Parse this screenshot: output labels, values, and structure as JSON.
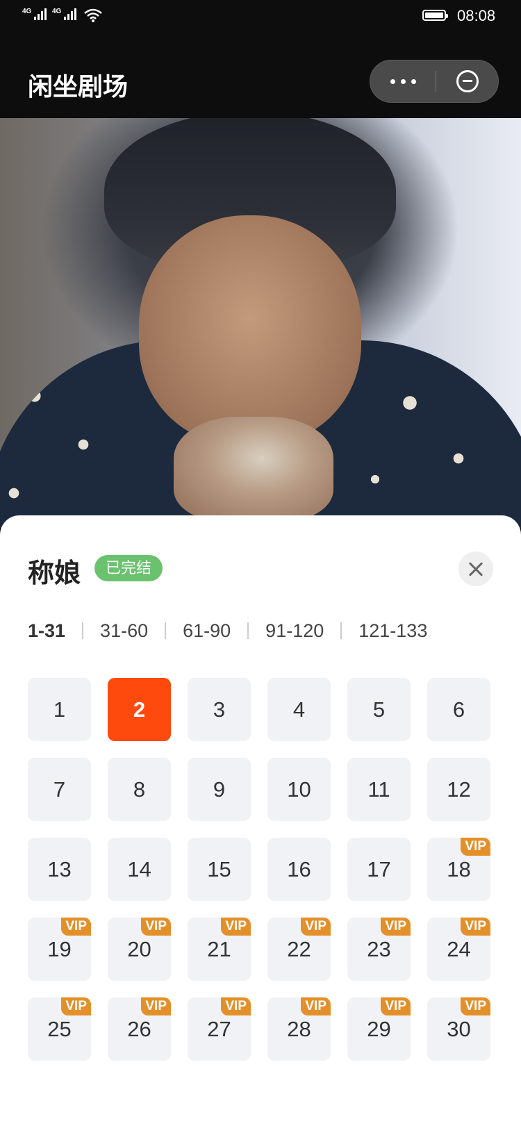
{
  "status_bar": {
    "signal1_label": "4G",
    "signal2_label": "4G",
    "time": "08:08"
  },
  "header": {
    "title": "闲坐剧场"
  },
  "sheet": {
    "title": "称娘",
    "status": "已完结",
    "ranges": [
      {
        "label": "1-31",
        "active": true
      },
      {
        "label": "31-60",
        "active": false
      },
      {
        "label": "61-90",
        "active": false
      },
      {
        "label": "91-120",
        "active": false
      },
      {
        "label": "121-133",
        "active": false
      }
    ],
    "vip_label": "VIP",
    "episodes": [
      {
        "num": "1",
        "vip": false,
        "active": false
      },
      {
        "num": "2",
        "vip": false,
        "active": true
      },
      {
        "num": "3",
        "vip": false,
        "active": false
      },
      {
        "num": "4",
        "vip": false,
        "active": false
      },
      {
        "num": "5",
        "vip": false,
        "active": false
      },
      {
        "num": "6",
        "vip": false,
        "active": false
      },
      {
        "num": "7",
        "vip": false,
        "active": false
      },
      {
        "num": "8",
        "vip": false,
        "active": false
      },
      {
        "num": "9",
        "vip": false,
        "active": false
      },
      {
        "num": "10",
        "vip": false,
        "active": false
      },
      {
        "num": "11",
        "vip": false,
        "active": false
      },
      {
        "num": "12",
        "vip": false,
        "active": false
      },
      {
        "num": "13",
        "vip": false,
        "active": false
      },
      {
        "num": "14",
        "vip": false,
        "active": false
      },
      {
        "num": "15",
        "vip": false,
        "active": false
      },
      {
        "num": "16",
        "vip": false,
        "active": false
      },
      {
        "num": "17",
        "vip": false,
        "active": false
      },
      {
        "num": "18",
        "vip": true,
        "active": false
      },
      {
        "num": "19",
        "vip": true,
        "active": false
      },
      {
        "num": "20",
        "vip": true,
        "active": false
      },
      {
        "num": "21",
        "vip": true,
        "active": false
      },
      {
        "num": "22",
        "vip": true,
        "active": false
      },
      {
        "num": "23",
        "vip": true,
        "active": false
      },
      {
        "num": "24",
        "vip": true,
        "active": false
      },
      {
        "num": "25",
        "vip": true,
        "active": false
      },
      {
        "num": "26",
        "vip": true,
        "active": false
      },
      {
        "num": "27",
        "vip": true,
        "active": false
      },
      {
        "num": "28",
        "vip": true,
        "active": false
      },
      {
        "num": "29",
        "vip": true,
        "active": false
      },
      {
        "num": "30",
        "vip": true,
        "active": false
      }
    ]
  },
  "colors": {
    "accent": "#ff4a0d",
    "vip": "#e4902a",
    "completed": "#6ac26f"
  }
}
